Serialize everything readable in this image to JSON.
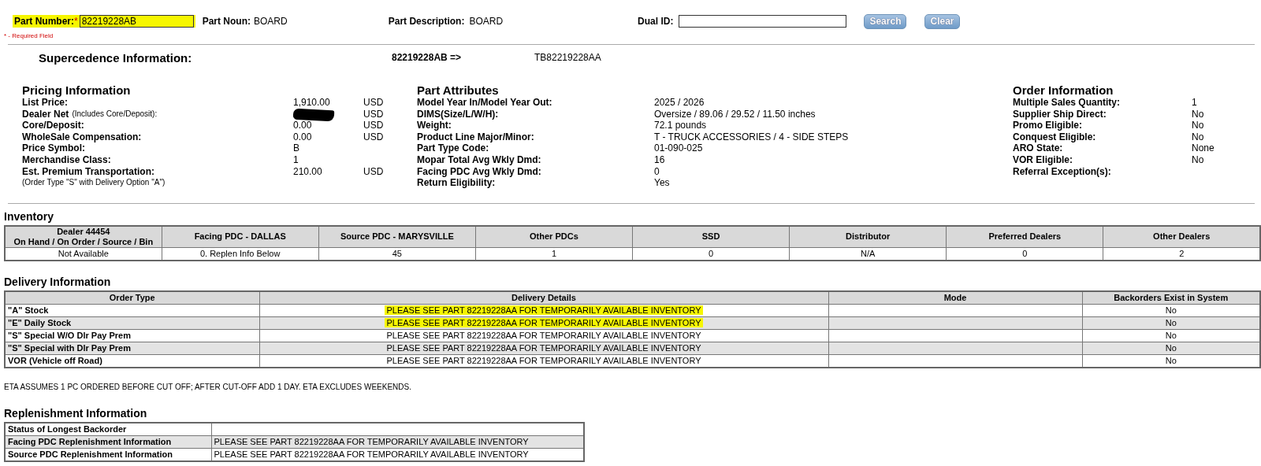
{
  "search": {
    "part_number": {
      "label": "Part Number:",
      "required_mark": "*",
      "value": "82219228AB",
      "highlighted": true
    },
    "part_noun": {
      "label": "Part Noun:",
      "value": "BOARD"
    },
    "part_description": {
      "label": "Part Description:",
      "value": "BOARD"
    },
    "dual_id": {
      "label": "Dual ID:"
    },
    "buttons": [
      "Search",
      "Clear"
    ],
    "required_note": "* - Required Field"
  },
  "supercedence": {
    "title": "Supercedence Information:",
    "from": "82219228AB =>",
    "to": "TB82219228AA"
  },
  "pricing": {
    "title": "Pricing Information",
    "rows": [
      {
        "label": "List Price:",
        "value": "1,910.00",
        "currency": "USD"
      },
      {
        "label": "Dealer Net",
        "note": "(Includes Core/Deposit):",
        "redacted": true,
        "currency": "USD"
      },
      {
        "label": "Core/Deposit:",
        "value": "0.00",
        "currency": "USD"
      },
      {
        "label": "WholeSale Compensation:",
        "value": "0.00",
        "currency": "USD"
      },
      {
        "label": "Price Symbol:",
        "value": "B"
      },
      {
        "label": "Merchandise Class:",
        "value": "1"
      },
      {
        "label": "Est. Premium Transportation:",
        "value": "210.00",
        "currency": "USD"
      }
    ],
    "footnote": "(Order Type \"S\" with Delivery Option \"A\")"
  },
  "part_attributes": {
    "title": "Part Attributes",
    "rows": [
      {
        "label": "Model Year In/Model Year Out:",
        "value": "2025 / 2026"
      },
      {
        "label": "DIMS(Size/L/W/H):",
        "value": "Oversize / 89.06 / 29.52 / 11.50  inches"
      },
      {
        "label": "Weight:",
        "value": "72.1  pounds"
      },
      {
        "label": "Product Line Major/Minor:",
        "value": "T - TRUCK ACCESSORIES / 4 - SIDE STEPS"
      },
      {
        "label": "Part Type Code:",
        "value": "01-090-025"
      },
      {
        "label": "Mopar Total Avg Wkly Dmd:",
        "value": "16"
      },
      {
        "label": "Facing PDC Avg Wkly Dmd:",
        "value": "0"
      },
      {
        "label": "Return Eligibility:",
        "value": "Yes"
      }
    ]
  },
  "order_information": {
    "title": "Order Information",
    "rows": [
      {
        "label": "Multiple Sales Quantity:",
        "value": "1"
      },
      {
        "label": "Supplier Ship Direct:",
        "value": "No"
      },
      {
        "label": "Promo Eligible:",
        "value": "No"
      },
      {
        "label": "Conquest Eligible:",
        "value": "No"
      },
      {
        "label": "ARO State:",
        "value": "None"
      },
      {
        "label": "VOR Eligible:",
        "value": "No"
      },
      {
        "label": "Referral Exception(s):"
      }
    ]
  },
  "inventory": {
    "title": "Inventory",
    "columns": [
      "Dealer 44454\nOn Hand / On Order / Source / Bin",
      "Facing PDC - DALLAS",
      "Source PDC - MARYSVILLE",
      "Other PDCs",
      "SSD",
      "Distributor",
      "Preferred Dealers",
      "Other Dealers"
    ],
    "rows": [
      {
        "cells": [
          "Not Available",
          "0. Replen Info Below",
          "45",
          "1",
          "0",
          "N/A",
          "0",
          "2"
        ]
      }
    ]
  },
  "delivery": {
    "title": "Delivery Information",
    "columns": [
      "Order Type",
      "Delivery Details",
      "Mode",
      "Backorders Exist in System"
    ],
    "rows": [
      {
        "cells": [
          "\"A\" Stock",
          "PLEASE SEE PART 82219228AA FOR TEMPORARILY AVAILABLE INVENTORY",
          "",
          "No"
        ],
        "highlighted": true
      },
      {
        "cells": [
          "\"E\" Daily Stock",
          "PLEASE SEE PART 82219228AA FOR TEMPORARILY AVAILABLE INVENTORY",
          "",
          "No"
        ],
        "highlighted": true
      },
      {
        "cells": [
          "\"S\" Special W/O Dlr Pay Prem",
          "PLEASE SEE PART 82219228AA FOR TEMPORARILY AVAILABLE INVENTORY",
          "",
          "No"
        ],
        "highlighted": false
      },
      {
        "cells": [
          "\"S\" Special with Dlr Pay Prem",
          "PLEASE SEE PART 82219228AA FOR TEMPORARILY AVAILABLE INVENTORY",
          "",
          "No"
        ],
        "highlighted": false
      },
      {
        "cells": [
          "VOR (Vehicle off Road)",
          "PLEASE SEE PART 82219228AA FOR TEMPORARILY AVAILABLE INVENTORY",
          "",
          "No"
        ],
        "highlighted": false
      }
    ]
  },
  "eta_note": "ETA ASSUMES 1 PC ORDERED BEFORE CUT OFF; AFTER CUT-OFF ADD 1 DAY. ETA EXCLUDES WEEKENDS.",
  "replenishment": {
    "title": "Replenishment Information",
    "rows": [
      {
        "cells": [
          "Status of Longest Backorder",
          ""
        ]
      },
      {
        "cells": [
          "Facing PDC Replenishment Information",
          "PLEASE SEE PART 82219228AA FOR TEMPORARILY AVAILABLE INVENTORY"
        ]
      },
      {
        "cells": [
          "Source PDC Replenishment Information",
          "PLEASE SEE PART 82219228AA FOR TEMPORARILY AVAILABLE INVENTORY"
        ]
      }
    ]
  }
}
